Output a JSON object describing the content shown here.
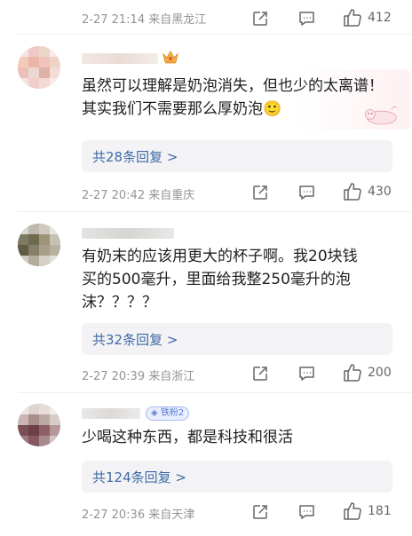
{
  "top_meta": {
    "date_location": "2-27 21:14  来自黑龙江",
    "likes": "412"
  },
  "comments": [
    {
      "text": "虽然可以理解是奶泡消失，但也少的太离谱！其实我们不需要那么厚奶泡",
      "emoji": "🙂",
      "replies": "共28条回复 >",
      "date_location": "2-27 20:42  来自重庆",
      "likes": "430"
    },
    {
      "text_lines": [
        "有奶末的应该用更大的杯子啊。我20块钱",
        "买的500毫升，里面给我整250毫升的泡",
        "沫？？？？"
      ],
      "replies": "共32条回复 >",
      "date_location": "2-27 20:39  来自浙江",
      "likes": "200"
    },
    {
      "badge": "铁粉2",
      "text": "少喝这种东西，都是科技和很活",
      "replies": "共124条回复 >",
      "date_location": "2-27 20:36  来自天津",
      "likes": "181"
    }
  ],
  "icons": {
    "share": "share-square-icon",
    "comment": "comment-bubble-icon",
    "like": "thumbs-up-icon",
    "crown": "crown-icon"
  },
  "colors": {
    "link": "#3f6aa5",
    "meta": "#939393",
    "reply_bg": "#f3f3f5"
  }
}
